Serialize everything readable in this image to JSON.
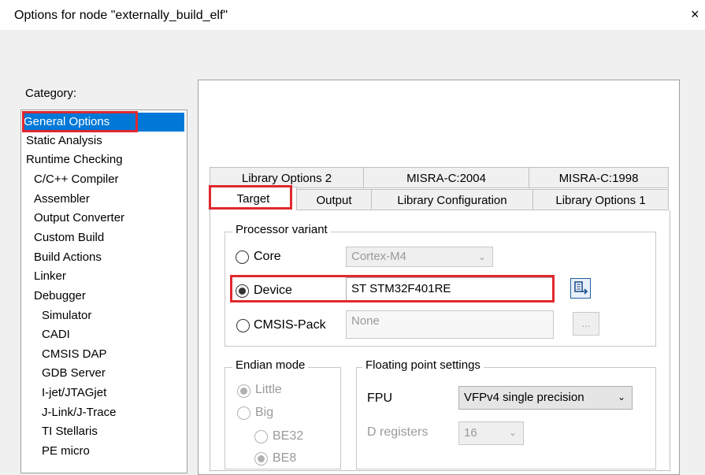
{
  "window": {
    "title": "Options for node \"externally_build_elf\"",
    "close_label": "×"
  },
  "category": {
    "label": "Category:",
    "items": [
      "General Options",
      "Static Analysis",
      "Runtime Checking",
      "C/C++ Compiler",
      "Assembler",
      "Output Converter",
      "Custom Build",
      "Build Actions",
      "Linker",
      "Debugger",
      "Simulator",
      "CADI",
      "CMSIS DAP",
      "GDB Server",
      "I-jet/JTAGjet",
      "J-Link/J-Trace",
      "TI Stellaris",
      "PE micro"
    ],
    "selected": "General Options"
  },
  "tabs": {
    "row1": [
      "Library Options 2",
      "MISRA-C:2004",
      "MISRA-C:1998"
    ],
    "row2": [
      "Target",
      "Output",
      "Library Configuration",
      "Library Options 1"
    ],
    "active": "Target"
  },
  "processor": {
    "legend": "Processor variant",
    "core_label": "Core",
    "core_value": "Cortex-M4",
    "device_label": "Device",
    "device_value": "ST STM32F401RE",
    "cmsis_label": "CMSIS-Pack",
    "cmsis_value": "None",
    "browse_label": "...",
    "selected": "Device",
    "device_icon": "device-select-icon"
  },
  "endian": {
    "legend": "Endian mode",
    "little": "Little",
    "big": "Big",
    "be32": "BE32",
    "be8": "BE8",
    "selected": "Little"
  },
  "floating": {
    "legend": "Floating point settings",
    "fpu_label": "FPU",
    "fpu_value": "VFPv4 single precision",
    "dregs_label": "D registers",
    "dregs_value": "16"
  },
  "colors": {
    "highlight_box": "#e0282e",
    "selection": "#0078d7"
  }
}
